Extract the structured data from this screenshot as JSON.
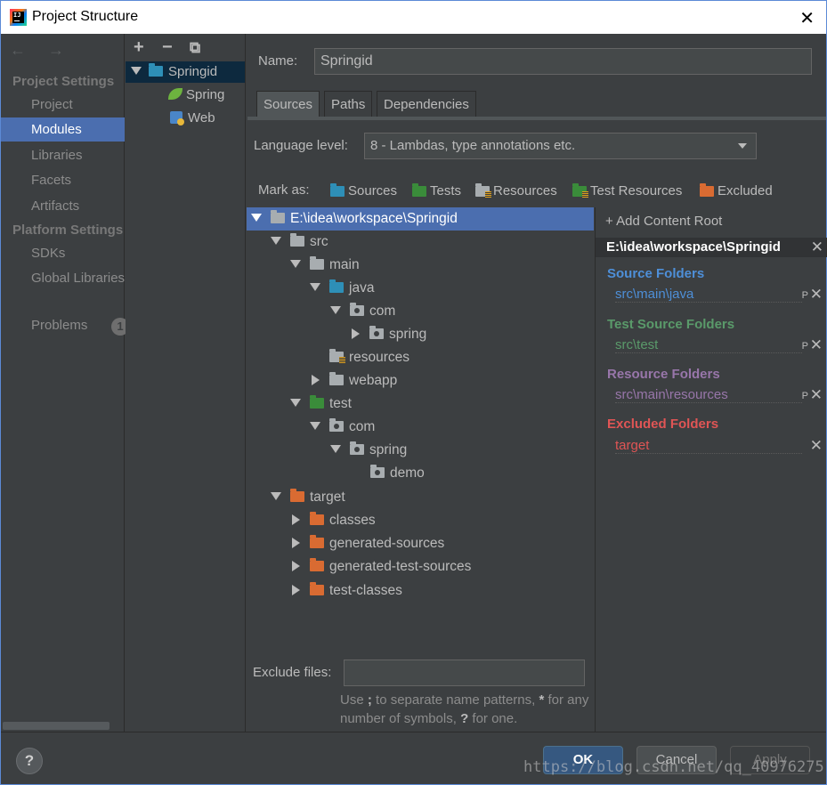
{
  "window": {
    "title": "Project Structure",
    "close_glyph": "✕"
  },
  "nav": {
    "arrows": "← →",
    "sections": [
      {
        "label": "Project Settings"
      },
      {
        "label": "Platform Settings"
      }
    ],
    "items": [
      {
        "label": "Project"
      },
      {
        "label": "Modules"
      },
      {
        "label": "Libraries"
      },
      {
        "label": "Facets"
      },
      {
        "label": "Artifacts"
      },
      {
        "label": "SDKs"
      },
      {
        "label": "Global Libraries"
      },
      {
        "label": "Problems"
      }
    ],
    "problems_count": "1"
  },
  "modules": {
    "toolbar": {
      "add": "+",
      "remove": "−",
      "copy": "⧉"
    },
    "tree": [
      {
        "label": "Springid"
      },
      {
        "label": "Spring"
      },
      {
        "label": "Web"
      }
    ]
  },
  "editor": {
    "name_label": "Name:",
    "name_value": "Springid",
    "tabs": [
      {
        "label": "Sources"
      },
      {
        "label": "Paths"
      },
      {
        "label": "Dependencies"
      }
    ],
    "language_level_label": "Language level:",
    "language_level_value": "8 - Lambdas, type annotations etc.",
    "mark_as_label": "Mark as:",
    "mark_buttons": [
      {
        "label": "Sources"
      },
      {
        "label": "Tests"
      },
      {
        "label": "Resources"
      },
      {
        "label": "Test Resources"
      },
      {
        "label": "Excluded"
      }
    ],
    "tree": [
      {
        "label": "E:\\idea\\workspace\\Springid"
      },
      {
        "label": "src"
      },
      {
        "label": "main"
      },
      {
        "label": "java"
      },
      {
        "label": "com"
      },
      {
        "label": "spring"
      },
      {
        "label": "resources"
      },
      {
        "label": "webapp"
      },
      {
        "label": "test"
      },
      {
        "label": "com"
      },
      {
        "label": "spring"
      },
      {
        "label": "demo"
      },
      {
        "label": "target"
      },
      {
        "label": "classes"
      },
      {
        "label": "generated-sources"
      },
      {
        "label": "generated-test-sources"
      },
      {
        "label": "test-classes"
      }
    ],
    "exclude_files_label": "Exclude files:",
    "exclude_files_value": "",
    "hint": {
      "part1": "Use",
      "sep": ";",
      "part2": "to separate name patterns,",
      "star1": "*",
      "part3": "for any number of symbols,",
      "q": "?",
      "part4": "for one."
    }
  },
  "content_roots": {
    "add_label": "+ Add Content Root",
    "root_path": "E:\\idea\\workspace\\Springid",
    "sections": [
      {
        "title": "Source Folders",
        "path": "src\\main\\java",
        "color": "#4e8fd8"
      },
      {
        "title": "Test Source Folders",
        "path": "src\\test",
        "color": "#5a9a6a"
      },
      {
        "title": "Resource Folders",
        "path": "src\\main\\resources",
        "color": "#9876aa"
      },
      {
        "title": "Excluded Folders",
        "path": "target",
        "color": "#e05555"
      }
    ],
    "prefix_mark": "P",
    "remove_glyph": "✕"
  },
  "buttons": {
    "help": "?",
    "ok": "OK",
    "cancel": "Cancel",
    "apply": "Apply"
  },
  "watermark": "https://blog.csdn.net/qq_40976275"
}
